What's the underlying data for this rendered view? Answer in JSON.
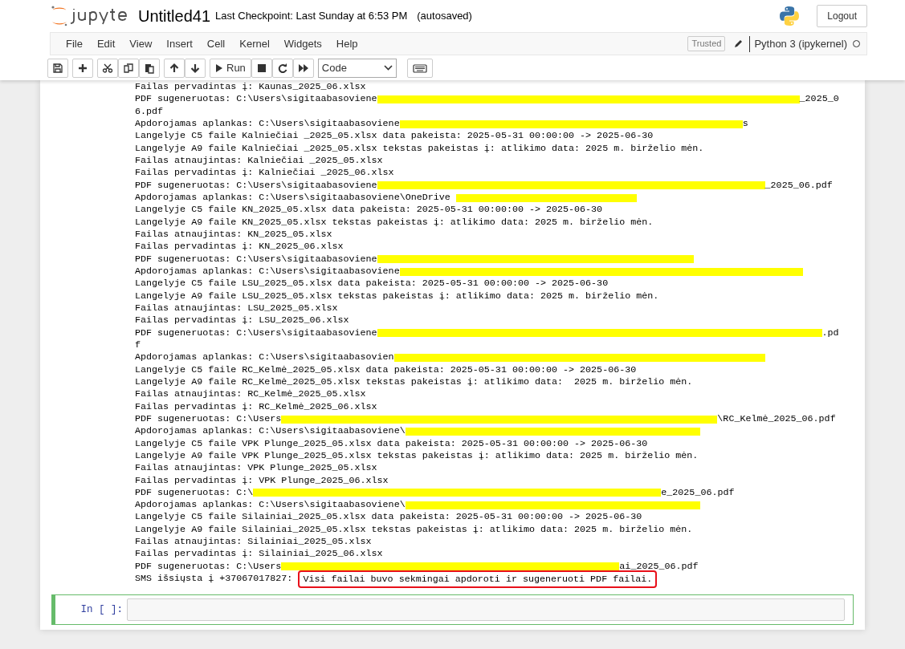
{
  "header": {
    "title": "Untitled41",
    "checkpoint": "Last Checkpoint: Last Sunday at 6:53 PM",
    "save_status": "(autosaved)",
    "logout": "Logout"
  },
  "menu": [
    "File",
    "Edit",
    "View",
    "Insert",
    "Cell",
    "Kernel",
    "Widgets",
    "Help"
  ],
  "trusted": "Trusted",
  "kernel": "Python 3 (ipykernel)",
  "kernel_busy": false,
  "toolbar": {
    "run": "Run",
    "cell_type": "Code"
  },
  "output": [
    [
      {
        "kind": "text",
        "text": "Failas pervadintas į: Kaunas_2025_06.xlsx"
      }
    ],
    [
      {
        "kind": "text",
        "text": "PDF sugeneruotas: C:\\Users\\sigitaabasoviene"
      },
      {
        "kind": "redacted"
      },
      {
        "kind": "text",
        "text": "_2025_0"
      }
    ],
    [
      {
        "kind": "text",
        "text": "6.pdf"
      }
    ],
    [
      {
        "kind": "text",
        "text": "Apdorojamas aplankas: C:\\Users\\sigitaabasoviene"
      },
      {
        "kind": "redacted"
      },
      {
        "kind": "text",
        "text": "s"
      }
    ],
    [
      {
        "kind": "text",
        "text": "Langelyje C5 faile Kalniečiai _2025_05.xlsx data pakeista: 2025-05-31 00:00:00 -> 2025-06-30"
      }
    ],
    [
      {
        "kind": "text",
        "text": "Langelyje A9 faile Kalniečiai _2025_05.xlsx tekstas pakeistas į: atlikimo data: 2025 m. birželio mėn."
      }
    ],
    [
      {
        "kind": "text",
        "text": "Failas atnaujintas: Kalniečiai _2025_05.xlsx"
      }
    ],
    [
      {
        "kind": "text",
        "text": "Failas pervadintas į: Kalniečiai _2025_06.xlsx"
      }
    ],
    [
      {
        "kind": "text",
        "text": "PDF sugeneruotas: C:\\Users\\sigitaabasoviene"
      },
      {
        "kind": "redacted"
      },
      {
        "kind": "text",
        "text": "_2025_06.pdf"
      }
    ],
    [
      {
        "kind": "text",
        "text": "Apdorojamas aplankas: C:\\Users\\sigitaabasoviene\\OneDrive "
      },
      {
        "kind": "redacted"
      }
    ],
    [
      {
        "kind": "text",
        "text": "Langelyje C5 faile KN_2025_05.xlsx data pakeista: 2025-05-31 00:00:00 -> 2025-06-30"
      }
    ],
    [
      {
        "kind": "text",
        "text": "Langelyje A9 faile KN_2025_05.xlsx tekstas pakeistas į: atlikimo data: 2025 m. birželio mėn."
      }
    ],
    [
      {
        "kind": "text",
        "text": "Failas atnaujintas: KN_2025_05.xlsx"
      }
    ],
    [
      {
        "kind": "text",
        "text": "Failas pervadintas į: KN_2025_06.xlsx"
      }
    ],
    [
      {
        "kind": "text",
        "text": "PDF sugeneruotas: C:\\Users\\sigitaabasoviene"
      },
      {
        "kind": "redacted"
      }
    ],
    [
      {
        "kind": "text",
        "text": "Apdorojamas aplankas: C:\\Users\\sigitaabasoviene"
      },
      {
        "kind": "redacted"
      }
    ],
    [
      {
        "kind": "text",
        "text": "Langelyje C5 faile LSU_2025_05.xlsx data pakeista: 2025-05-31 00:00:00 -> 2025-06-30"
      }
    ],
    [
      {
        "kind": "text",
        "text": "Langelyje A9 faile LSU_2025_05.xlsx tekstas pakeistas į: atlikimo data: 2025 m. birželio mėn."
      }
    ],
    [
      {
        "kind": "text",
        "text": "Failas atnaujintas: LSU_2025_05.xlsx"
      }
    ],
    [
      {
        "kind": "text",
        "text": "Failas pervadintas į: LSU_2025_06.xlsx"
      }
    ],
    [
      {
        "kind": "text",
        "text": "PDF sugeneruotas: C:\\Users\\sigitaabasoviene"
      },
      {
        "kind": "redacted"
      },
      {
        "kind": "text",
        "text": ".pd"
      }
    ],
    [
      {
        "kind": "text",
        "text": "f"
      }
    ],
    [
      {
        "kind": "text",
        "text": "Apdorojamas aplankas: C:\\Users\\sigitaabasovien"
      },
      {
        "kind": "redacted"
      }
    ],
    [
      {
        "kind": "text",
        "text": "Langelyje C5 faile RC_Kelmė_2025_05.xlsx data pakeista: 2025-05-31 00:00:00 -> 2025-06-30"
      }
    ],
    [
      {
        "kind": "text",
        "text": "Langelyje A9 faile RC_Kelmė_2025_05.xlsx tekstas pakeistas į: atlikimo data:  2025 m. birželio mėn."
      }
    ],
    [
      {
        "kind": "text",
        "text": "Failas atnaujintas: RC_Kelmė_2025_05.xlsx"
      }
    ],
    [
      {
        "kind": "text",
        "text": "Failas pervadintas į: RC_Kelmė_2025_06.xlsx"
      }
    ],
    [
      {
        "kind": "text",
        "text": "PDF sugeneruotas: C:\\Users"
      },
      {
        "kind": "redacted"
      },
      {
        "kind": "text",
        "text": "\\RC_Kelmė_2025_06.pdf"
      }
    ],
    [
      {
        "kind": "text",
        "text": "Apdorojamas aplankas: C:\\Users\\sigitaabasoviene\\"
      },
      {
        "kind": "redacted"
      }
    ],
    [
      {
        "kind": "text",
        "text": "Langelyje C5 faile VPK Plunge_2025_05.xlsx data pakeista: 2025-05-31 00:00:00 -> 2025-06-30"
      }
    ],
    [
      {
        "kind": "text",
        "text": "Langelyje A9 faile VPK Plunge_2025_05.xlsx tekstas pakeistas į: atlikimo data: 2025 m. birželio mėn."
      }
    ],
    [
      {
        "kind": "text",
        "text": "Failas atnaujintas: VPK Plunge_2025_05.xlsx"
      }
    ],
    [
      {
        "kind": "text",
        "text": "Failas pervadintas į: VPK Plunge_2025_06.xlsx"
      }
    ],
    [
      {
        "kind": "text",
        "text": "PDF sugeneruotas: C:\\"
      },
      {
        "kind": "redacted"
      },
      {
        "kind": "text",
        "text": "e_2025_06.pdf"
      }
    ],
    [
      {
        "kind": "text",
        "text": "Apdorojamas aplankas: C:\\Users\\sigitaabasoviene\\"
      },
      {
        "kind": "redacted"
      }
    ],
    [
      {
        "kind": "text",
        "text": "Langelyje C5 faile Silainiai_2025_05.xlsx data pakeista: 2025-05-31 00:00:00 -> 2025-06-30"
      }
    ],
    [
      {
        "kind": "text",
        "text": "Langelyje A9 faile Silainiai_2025_05.xlsx tekstas pakeistas į: atlikimo data: 2025 m. birželio mėn."
      }
    ],
    [
      {
        "kind": "text",
        "text": "Failas atnaujintas: Silainiai_2025_05.xlsx"
      }
    ],
    [
      {
        "kind": "text",
        "text": "Failas pervadintas į: Silainiai_2025_06.xlsx"
      }
    ],
    [
      {
        "kind": "text",
        "text": "PDF sugeneruotas: C:\\Users"
      },
      {
        "kind": "redacted"
      },
      {
        "kind": "text",
        "text": "ai_2025_06.pdf"
      }
    ],
    [
      {
        "kind": "text",
        "text": "SMS išsiųsta į +37067017827: "
      },
      {
        "kind": "circled",
        "text": "Visi failai buvo sekmingai apdoroti ir sugeneruoti PDF failai."
      }
    ]
  ],
  "input_cell": {
    "prompt": "In [ ]:",
    "selected": true
  }
}
